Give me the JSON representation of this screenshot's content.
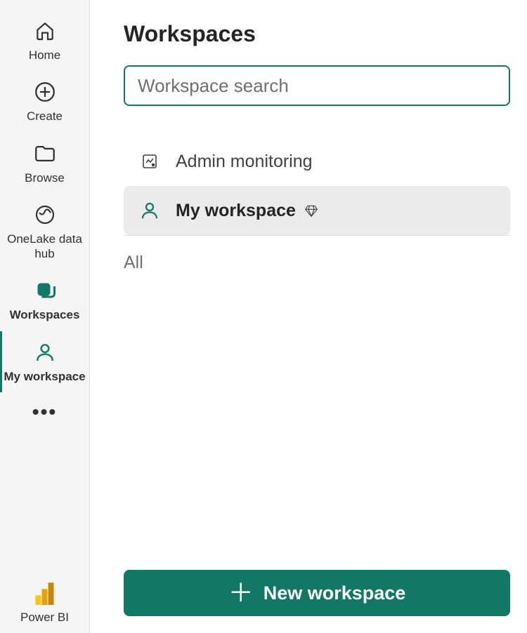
{
  "sidebar": {
    "items": [
      {
        "label": "Home"
      },
      {
        "label": "Create"
      },
      {
        "label": "Browse"
      },
      {
        "label": "OneLake data hub"
      },
      {
        "label": "Workspaces"
      },
      {
        "label": "My workspace"
      }
    ],
    "footer": {
      "label": "Power BI"
    }
  },
  "panel": {
    "title": "Workspaces",
    "search_placeholder": "Workspace search",
    "workspaces": [
      {
        "name": "Admin monitoring"
      },
      {
        "name": "My workspace"
      }
    ],
    "section_label": "All",
    "new_button_label": "New workspace"
  }
}
